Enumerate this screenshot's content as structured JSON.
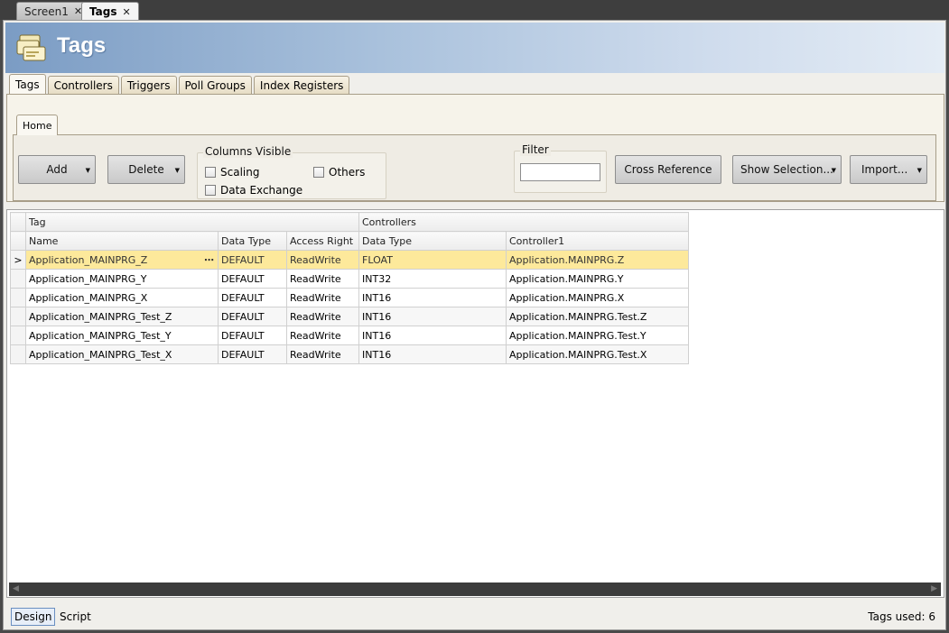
{
  "doc_tabs": [
    {
      "label": "Screen1",
      "close": "✕"
    },
    {
      "label": "Tags",
      "close": "✕"
    }
  ],
  "banner": {
    "title": "Tags",
    "icon": "tags-folder-icon"
  },
  "section_tabs": [
    "Tags",
    "Controllers",
    "Triggers",
    "Poll Groups",
    "Index Registers"
  ],
  "ribbon": {
    "tab": "Home",
    "add_label": "Add",
    "delete_label": "Delete",
    "columns_visible": {
      "title": "Columns Visible",
      "scaling": "Scaling",
      "others": "Others",
      "data_exchange": "Data Exchange"
    },
    "filter": {
      "title": "Filter",
      "value": ""
    },
    "cross_reference_label": "Cross Reference",
    "show_selection_label": "Show Selection...",
    "import_label": "Import..."
  },
  "grid": {
    "group_headers": {
      "tag": "Tag",
      "controllers": "Controllers"
    },
    "columns": [
      "Name",
      "Data Type",
      "Access Right",
      "Data Type",
      "Controller1"
    ],
    "rows": [
      [
        "Application_MAINPRG_Z",
        "DEFAULT",
        "ReadWrite",
        "FLOAT",
        "Application.MAINPRG.Z"
      ],
      [
        "Application_MAINPRG_Y",
        "DEFAULT",
        "ReadWrite",
        "INT32",
        "Application.MAINPRG.Y"
      ],
      [
        "Application_MAINPRG_X",
        "DEFAULT",
        "ReadWrite",
        "INT16",
        "Application.MAINPRG.X"
      ],
      [
        "Application_MAINPRG_Test_Z",
        "DEFAULT",
        "ReadWrite",
        "INT16",
        "Application.MAINPRG.Test.Z"
      ],
      [
        "Application_MAINPRG_Test_Y",
        "DEFAULT",
        "ReadWrite",
        "INT16",
        "Application.MAINPRG.Test.Y"
      ],
      [
        "Application_MAINPRG_Test_X",
        "DEFAULT",
        "ReadWrite",
        "INT16",
        "Application.MAINPRG.Test.X"
      ]
    ],
    "selected_row_marker": ">",
    "ellipsis": "⋯"
  },
  "status": {
    "design_tab": "Design",
    "script_tab": "Script",
    "tags_used": "Tags used: 6"
  }
}
